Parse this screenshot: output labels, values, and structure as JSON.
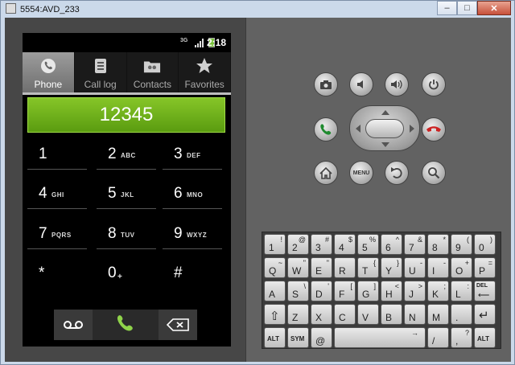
{
  "window": {
    "title": "5554:AVD_233"
  },
  "status": {
    "time": "2:18",
    "network": "3G"
  },
  "tabs": [
    {
      "label": "Phone",
      "icon": "phone-icon",
      "active": true
    },
    {
      "label": "Call log",
      "icon": "call-log-icon",
      "active": false
    },
    {
      "label": "Contacts",
      "icon": "contacts-icon",
      "active": false
    },
    {
      "label": "Favorites",
      "icon": "star-icon",
      "active": false
    }
  ],
  "dialer": {
    "number": "12345",
    "keys": [
      {
        "digit": "1",
        "letters": ""
      },
      {
        "digit": "2",
        "letters": "ABC"
      },
      {
        "digit": "3",
        "letters": "DEF"
      },
      {
        "digit": "4",
        "letters": "GHI"
      },
      {
        "digit": "5",
        "letters": "JKL"
      },
      {
        "digit": "6",
        "letters": "MNO"
      },
      {
        "digit": "7",
        "letters": "PQRS"
      },
      {
        "digit": "8",
        "letters": "TUV"
      },
      {
        "digit": "9",
        "letters": "WXYZ"
      },
      {
        "digit": "*",
        "letters": ""
      },
      {
        "digit": "0",
        "letters": "+"
      },
      {
        "digit": "#",
        "letters": ""
      }
    ]
  },
  "hardware": {
    "menu_label": "MENU"
  },
  "keyboard": {
    "rows": [
      [
        {
          "m": "1",
          "a": "!"
        },
        {
          "m": "2",
          "a": "@"
        },
        {
          "m": "3",
          "a": "#"
        },
        {
          "m": "4",
          "a": "$"
        },
        {
          "m": "5",
          "a": "%"
        },
        {
          "m": "6",
          "a": "^"
        },
        {
          "m": "7",
          "a": "&"
        },
        {
          "m": "8",
          "a": "*"
        },
        {
          "m": "9",
          "a": "("
        },
        {
          "m": "0",
          "a": ")"
        }
      ],
      [
        {
          "m": "Q",
          "a": "~"
        },
        {
          "m": "W",
          "a": "\""
        },
        {
          "m": "E",
          "a": "\""
        },
        {
          "m": "R",
          "a": ""
        },
        {
          "m": "T",
          "a": "{"
        },
        {
          "m": "Y",
          "a": "}"
        },
        {
          "m": "U",
          "a": "-"
        },
        {
          "m": "I",
          "a": "-"
        },
        {
          "m": "O",
          "a": "+"
        },
        {
          "m": "P",
          "a": "="
        }
      ],
      [
        {
          "m": "A",
          "a": ""
        },
        {
          "m": "S",
          "a": "\\"
        },
        {
          "m": "D",
          "a": "'"
        },
        {
          "m": "F",
          "a": "["
        },
        {
          "m": "G",
          "a": "]"
        },
        {
          "m": "H",
          "a": "<"
        },
        {
          "m": "J",
          "a": ">"
        },
        {
          "m": "K",
          "a": ";"
        },
        {
          "m": "L",
          "a": ":"
        },
        {
          "m": "DEL",
          "a": ""
        }
      ],
      [
        {
          "m": "⇧",
          "a": ""
        },
        {
          "m": "Z",
          "a": ""
        },
        {
          "m": "X",
          "a": ""
        },
        {
          "m": "C",
          "a": ""
        },
        {
          "m": "V",
          "a": ""
        },
        {
          "m": "B",
          "a": ""
        },
        {
          "m": "N",
          "a": ""
        },
        {
          "m": "M",
          "a": ""
        },
        {
          "m": ".",
          "a": ""
        },
        {
          "m": "↵",
          "a": ""
        }
      ],
      [
        {
          "m": "ALT",
          "a": ""
        },
        {
          "m": "SYM",
          "a": ""
        },
        {
          "m": "@",
          "a": ""
        },
        {
          "m": "",
          "a": "→"
        },
        {
          "m": "/",
          "a": ""
        },
        {
          "m": ",",
          "a": "?"
        },
        {
          "m": "ALT",
          "a": ""
        }
      ]
    ]
  },
  "colors": {
    "accent_green": "#7fc22a",
    "call_green": "#8fd34a",
    "endcall_red": "#cc2222"
  }
}
